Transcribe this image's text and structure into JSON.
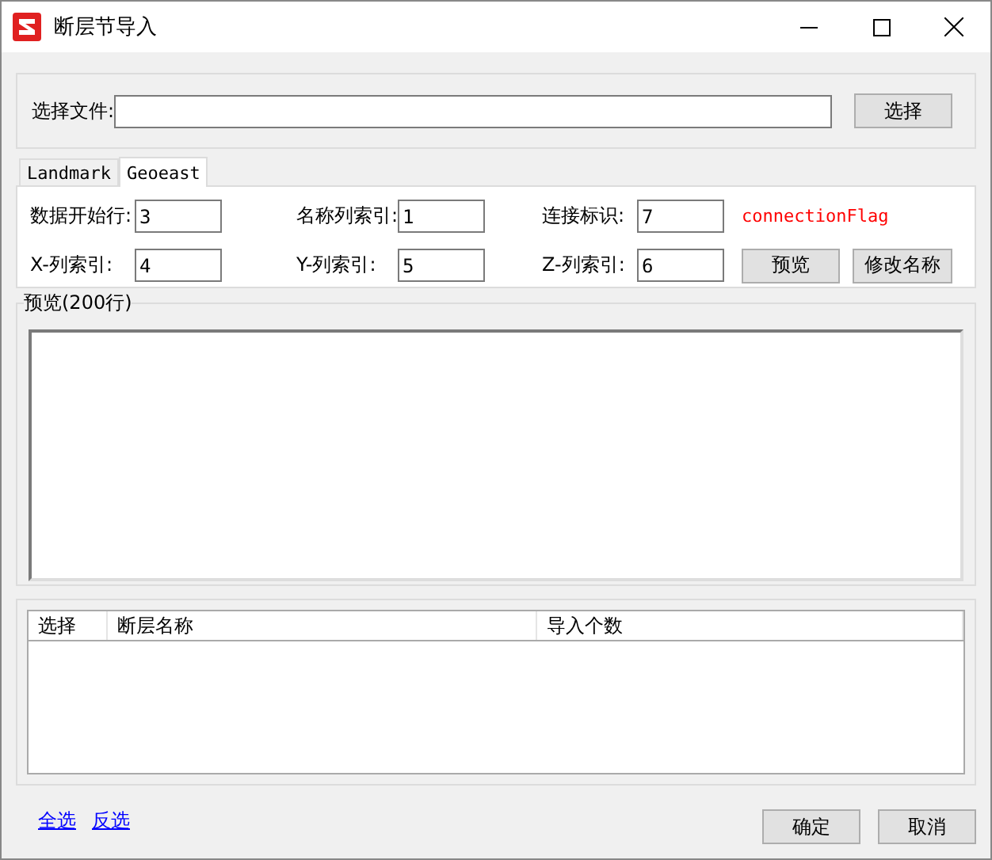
{
  "window": {
    "title": "断层节导入"
  },
  "file_group": {
    "label": "选择文件:",
    "button": "选择"
  },
  "tabs": [
    {
      "label": "Landmark",
      "selected": false
    },
    {
      "label": "Geoeast",
      "selected": true
    }
  ],
  "params": [
    {
      "label": "数据开始行:",
      "value": "3"
    },
    {
      "label": "名称列索引:",
      "value": "1"
    },
    {
      "label": "连接标识:",
      "value": "7"
    },
    {
      "label": "X-列索引:",
      "value": "4"
    },
    {
      "label": "Y-列索引:",
      "value": "5"
    },
    {
      "label": "Z-列索引:",
      "value": "6"
    }
  ],
  "flag_hint": "connectionFlag",
  "param_buttons": [
    "预览",
    "修改名称"
  ],
  "preview": {
    "title": "预览(200行)"
  },
  "table": {
    "columns": [
      "选择",
      "断层名称",
      "导入个数"
    ]
  },
  "links": [
    "全选",
    "反选"
  ],
  "buttons": [
    "确定",
    "取消"
  ]
}
